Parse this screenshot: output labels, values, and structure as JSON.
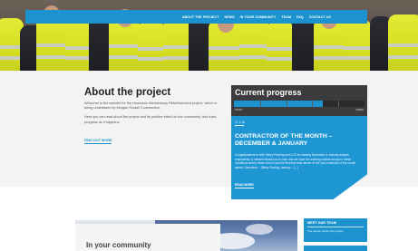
{
  "nav": {
    "items": [
      "ABOUT THE PROJECT",
      "NEWS",
      "IN YOUR COMMUNITY",
      "TEAM",
      "FAQ",
      "CONTACT US"
    ]
  },
  "about": {
    "title": "About the project",
    "paragraph1": "Welcome to the website for the Hounslow Wednesbury Refurbishment project, which is being undertaken by Morgan Sindall Construction.",
    "paragraph2": "Here you can read about the project and its positive effect on the community, and track progress as it happens.",
    "link": "FIND OUT MORE"
  },
  "progress": {
    "title": "Current progress",
    "start_label": "START",
    "finish_label": "FINISH",
    "fraction": 0.68
  },
  "news": {
    "date": "07.1.16",
    "title": "CONTRACTOR OF THE MONTH – DECEMBER & JANUARY",
    "body": "Congratulations to both Sibley Roofing and LCE for earning December & January awards respectively. A massive thank you to both and we hope the working outside all day in harsh conditions and to those who is now the final few time winner of the sub-contractor of the month award. December – Sibley Roofing January – [...]",
    "read_more": "READ MORE"
  },
  "community": {
    "title": "In your community"
  },
  "team": {
    "title": "MEET OUR TEAM",
    "subtitle": "The people behind the project"
  },
  "colors": {
    "accent": "#1c93cf",
    "dark_panel": "#3c3c3e",
    "vest_yellow": "#d6df22"
  }
}
